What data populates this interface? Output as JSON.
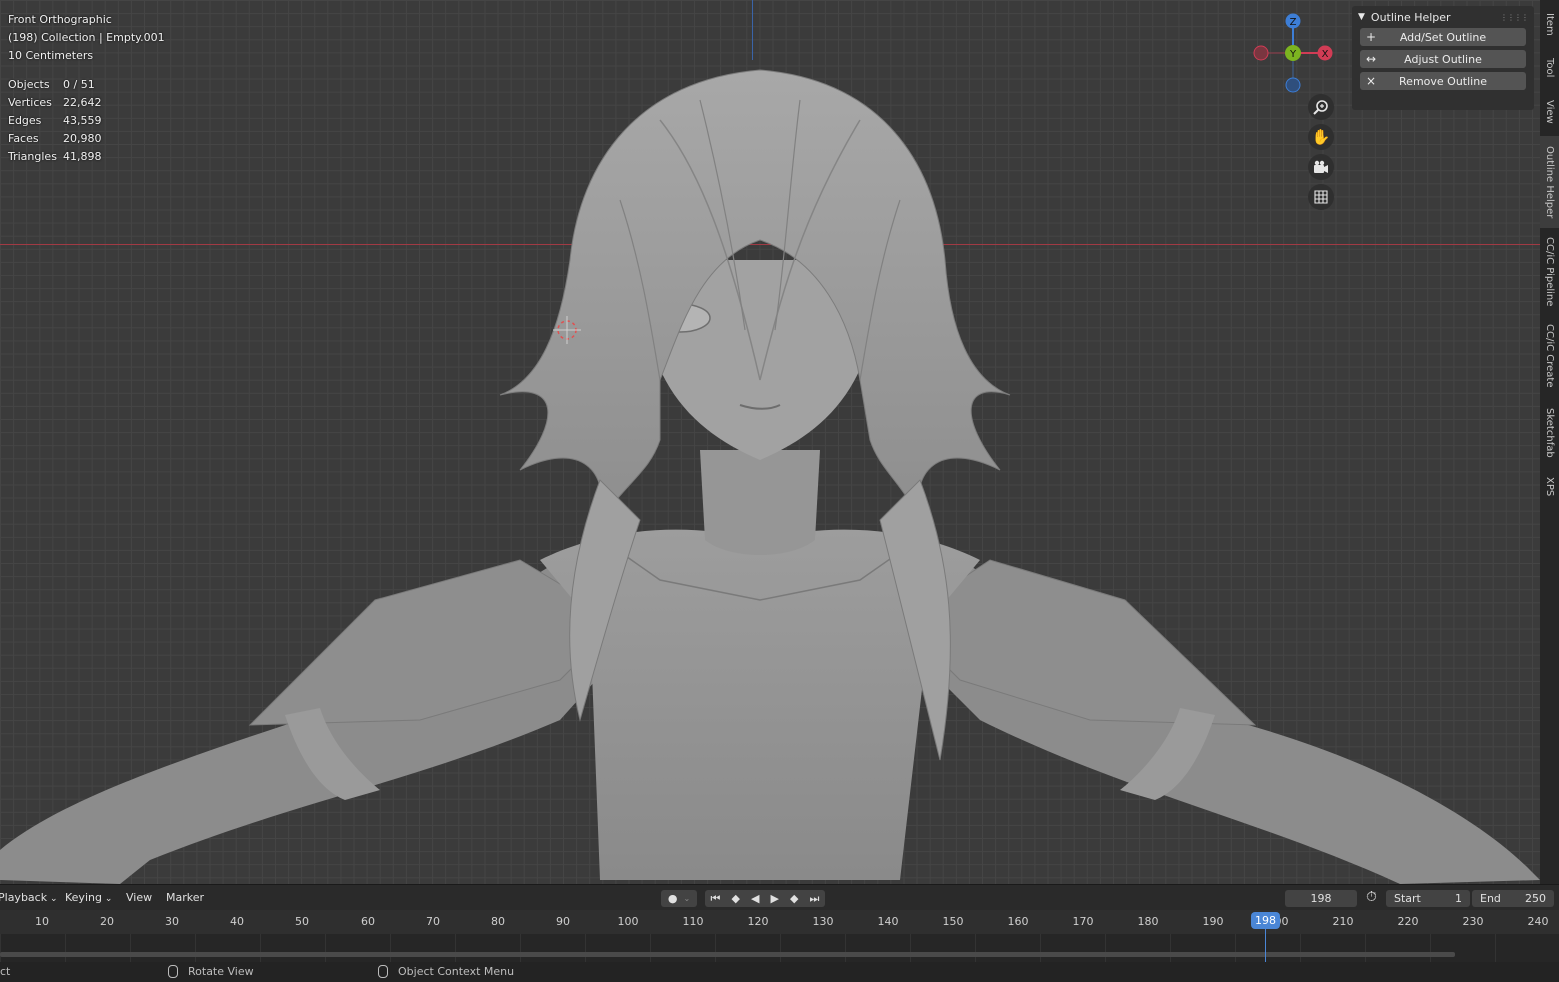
{
  "viewport": {
    "view_name": "Front Orthographic",
    "collection_info": "(198) Collection | Empty.001",
    "scale": "10 Centimeters",
    "stats": [
      {
        "label": "Objects",
        "value": "0 / 51"
      },
      {
        "label": "Vertices",
        "value": "22,642"
      },
      {
        "label": "Edges",
        "value": "43,559"
      },
      {
        "label": "Faces",
        "value": "20,980"
      },
      {
        "label": "Triangles",
        "value": "41,898"
      }
    ]
  },
  "gizmo": {
    "z": "Z",
    "y": "Y",
    "x": "X",
    "x_color": "#d13c55",
    "y_color": "#7cb420",
    "z_color": "#3d7ed6"
  },
  "nav_icons": [
    "zoom-icon",
    "hand-pan-icon",
    "camera-icon",
    "grid-icon"
  ],
  "panel": {
    "title": "Outline Helper",
    "buttons": [
      {
        "icon": "+",
        "label": "Add/Set Outline"
      },
      {
        "icon": "↔",
        "label": "Adjust Outline"
      },
      {
        "icon": "×",
        "label": "Remove Outline"
      }
    ]
  },
  "side_tabs": [
    "Item",
    "Tool",
    "View",
    "Outline Helper",
    "CC/iC Pipeline",
    "CC/iC Create",
    "Sketchfab",
    "XPS"
  ],
  "timeline": {
    "menus": [
      "Playback",
      "Keying",
      "View",
      "Marker"
    ],
    "current_frame": "198",
    "start_label": "Start",
    "start_value": "1",
    "end_label": "End",
    "end_value": "250",
    "ruler_ticks": [
      "10",
      "20",
      "30",
      "40",
      "50",
      "60",
      "70",
      "80",
      "90",
      "100",
      "110",
      "120",
      "130",
      "140",
      "150",
      "160",
      "170",
      "180",
      "190",
      "200",
      "210",
      "220",
      "230",
      "240"
    ],
    "playhead": "198"
  },
  "statusbar": {
    "left": "ct",
    "rotate": "Rotate View",
    "context": "Object Context Menu"
  }
}
